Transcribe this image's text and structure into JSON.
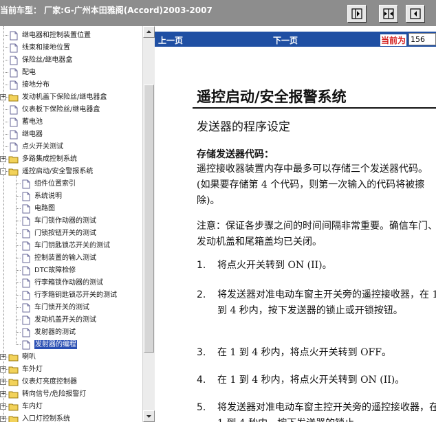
{
  "window": {
    "title": "当前车型：  厂家:G-广州本田雅阁(Accord)2003-2007",
    "buttons": [
      {
        "name": "show-tree-button"
      },
      {
        "name": "show-both-button"
      },
      {
        "name": "show-document-button"
      }
    ]
  },
  "tree": {
    "items": [
      {
        "label": "继电器和控制装置位置",
        "type": "doc",
        "level": 1
      },
      {
        "label": "线束和接地位置",
        "type": "doc",
        "level": 1
      },
      {
        "label": "保险丝/继电器盒",
        "type": "doc",
        "level": 1
      },
      {
        "label": "配电",
        "type": "doc",
        "level": 1
      },
      {
        "label": "接地分布",
        "type": "doc",
        "level": 1
      },
      {
        "label": "发动机盖下保险丝/继电器盒",
        "type": "folder",
        "level": 1,
        "expander": "+"
      },
      {
        "label": "仪表板下保险丝/继电器盒",
        "type": "doc",
        "level": 1
      },
      {
        "label": "蓄电池",
        "type": "doc",
        "level": 1
      },
      {
        "label": "继电器",
        "type": "doc",
        "level": 1
      },
      {
        "label": "点火开关测试",
        "type": "doc",
        "level": 1
      },
      {
        "label": "多路集成控制系统",
        "type": "folder",
        "level": 1,
        "expander": "+"
      },
      {
        "label": "遥控启动/安全警报系统",
        "type": "folder-open",
        "level": 1,
        "expander": "-"
      },
      {
        "label": "组件位置索引",
        "type": "doc",
        "level": 2
      },
      {
        "label": "系统说明",
        "type": "doc",
        "level": 2
      },
      {
        "label": "电路图",
        "type": "doc",
        "level": 2
      },
      {
        "label": "车门锁作动器的测试",
        "type": "doc",
        "level": 2
      },
      {
        "label": "门锁按钮开关的测试",
        "type": "doc",
        "level": 2
      },
      {
        "label": "车门钥匙锁芯开关的测试",
        "type": "doc",
        "level": 2
      },
      {
        "label": "控制装置的输入测试",
        "type": "doc",
        "level": 2
      },
      {
        "label": "DTC故障检修",
        "type": "doc",
        "level": 2
      },
      {
        "label": "行李箱锁作动器的测试",
        "type": "doc",
        "level": 2
      },
      {
        "label": "行李箱钥匙锁芯开关的测试",
        "type": "doc",
        "level": 2
      },
      {
        "label": "车门锁开关的测试",
        "type": "doc",
        "level": 2
      },
      {
        "label": "发动机盖开关的测试",
        "type": "doc",
        "level": 2
      },
      {
        "label": "发射器的测试",
        "type": "doc",
        "level": 2
      },
      {
        "label": "发射器的编程",
        "type": "doc",
        "level": 2,
        "selected": true
      },
      {
        "label": "喇叭",
        "type": "folder",
        "level": 1,
        "expander": "+"
      },
      {
        "label": "车外灯",
        "type": "folder",
        "level": 1,
        "expander": "+"
      },
      {
        "label": "仪表灯亮度控制器",
        "type": "folder",
        "level": 1,
        "expander": "+"
      },
      {
        "label": "转向信号/危险报警灯",
        "type": "folder",
        "level": 1,
        "expander": "+"
      },
      {
        "label": "车内灯",
        "type": "folder",
        "level": 1,
        "expander": "+"
      },
      {
        "label": "入口灯控制系统",
        "type": "folder",
        "level": 1,
        "expander": "+"
      }
    ]
  },
  "nav": {
    "prev_label": "上一页",
    "next_label": "下一页",
    "current_label": "当前为",
    "page_value": "156"
  },
  "document": {
    "title": "遥控启动/安全报警系统",
    "subtitle": "发送器的程序设定",
    "heading": "存储发送器代码：",
    "para1": "遥控接收器装置内存中最多可以存储三个发送器代码。(如果要存储第 4 个代码，则第一次输入的代码将被擦除)。",
    "para2": "注意：保证各步骤之间的时间间隔非常重要。确信车门、发动机盖和尾箱盖均已关闭。",
    "steps": [
      {
        "num": "1.",
        "text": "将点火开关转到 ON (II)。"
      },
      {
        "num": "2.",
        "text": "将发送器对准电动车窗主开关旁的遥控接收器，在 1 到 4 秒内，按下发送器的锁止或开锁按钮。"
      },
      {
        "num": "3.",
        "text": "在 1 到 4 秒内，将点火开关转到 OFF。"
      },
      {
        "num": "4.",
        "text": "在 1 到 4 秒内，将点火开关转到 ON (II)。"
      },
      {
        "num": "5.",
        "text": "将发送器对准电动车窗主控开关旁的遥控接收器，在 1 到 4 秒内，按下发送器的锁止"
      }
    ]
  },
  "colors": {
    "titlebar": "#8d8d8d",
    "navbar": "#1f4fa3",
    "selection": "#2a4fb3",
    "current_label": "#d42020",
    "folder": "#f2d25a"
  }
}
